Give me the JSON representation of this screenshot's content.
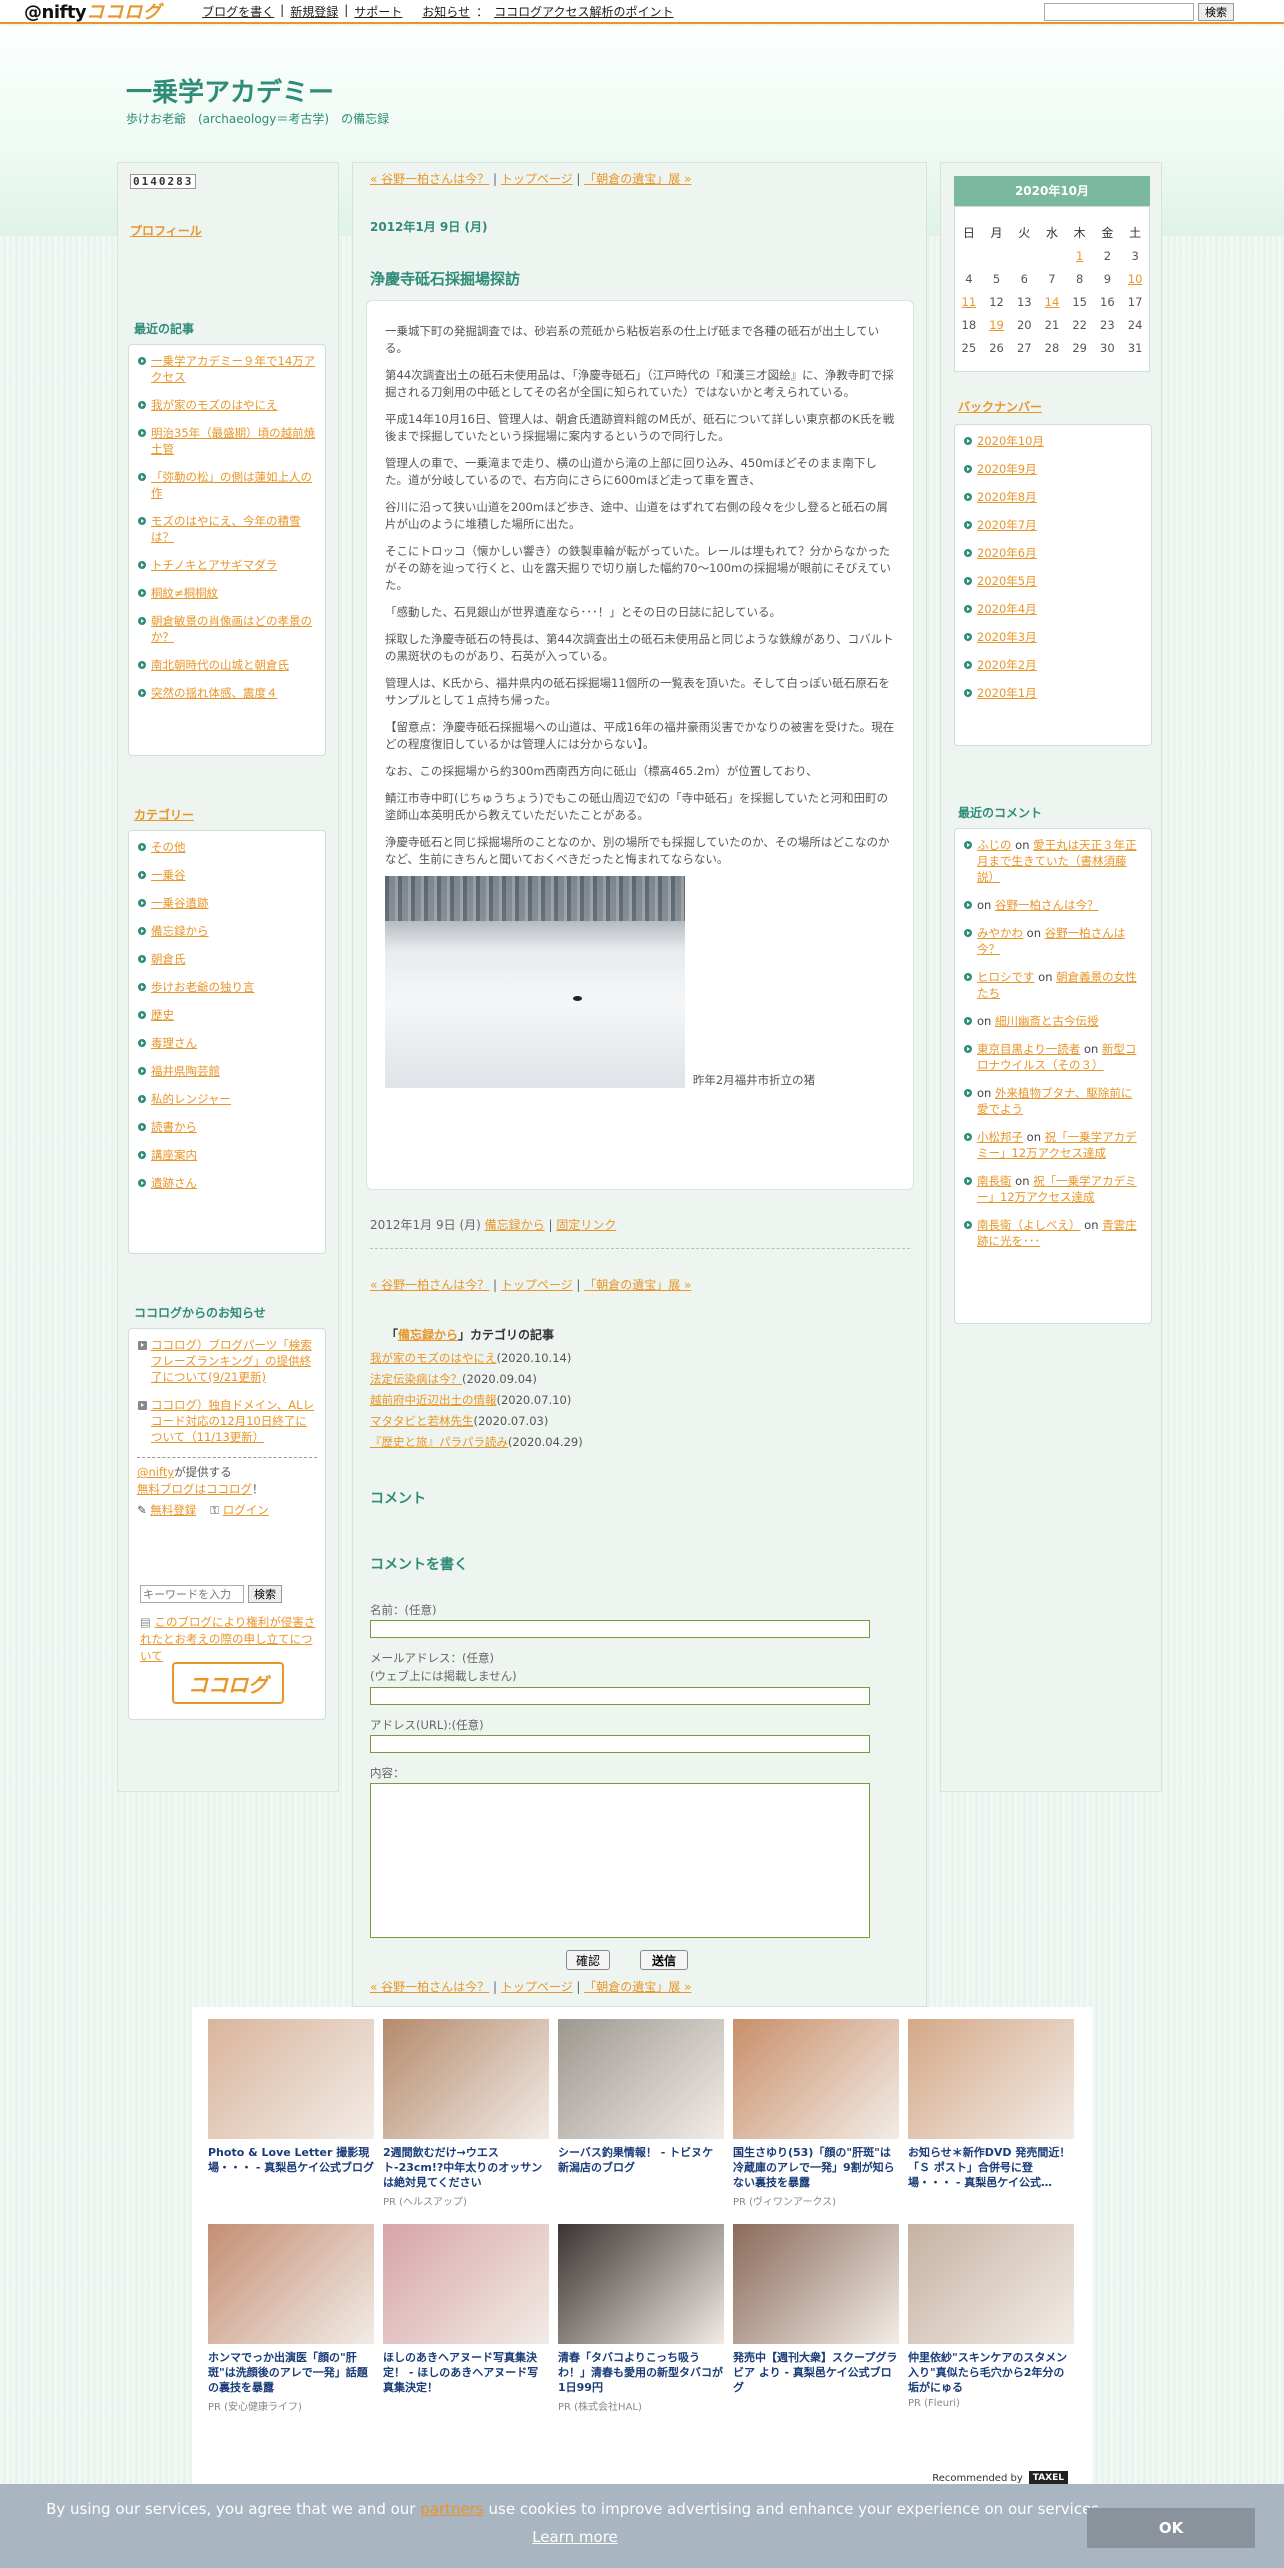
{
  "topbar": {
    "logo_text": "@nifty",
    "logo_brand": "ココログ",
    "nav": [
      "ブログを書く",
      "新規登録",
      "サポート"
    ],
    "news_label": "お知らせ",
    "news_link": "ココログアクセス解析のポイント",
    "search_button": "検索"
  },
  "site": {
    "title": "一乗学アカデミー",
    "description": "歩けお老爺　(archaeology＝考古学)　の備忘録"
  },
  "left": {
    "counter": "0140283",
    "profile": "プロフィール",
    "recent_heading": "最近の記事",
    "recent_items": [
      "一乗学アカデミー９年で14万アクセス",
      "我が家のモズのはやにえ",
      "明治35年（最盛期）頃の越前焼土管",
      "「弥勒の松」の側は蓮如上人の作",
      "モズのはやにえ、今年の積雪は？",
      "トチノキとアサギマダラ",
      "桐紋≠桐桐紋",
      "朝倉敏景の肖像画はどの孝景のか？",
      "南北朝時代の山城と朝倉氏",
      "突然の揺れ体感、震度４"
    ],
    "category_heading": "カテゴリー",
    "category_items": [
      "その他",
      "一乗谷",
      "一乗谷遺跡",
      "備忘録から",
      "朝倉氏",
      "歩けお老爺の独り言",
      "歴史",
      "毒理さん",
      "福井県陶芸館",
      "私的レンジャー",
      "読書から",
      "講座案内",
      "遺跡さん"
    ],
    "notice_heading": "ココログからのお知らせ",
    "notice_items": [
      "ココログ）ブログパーツ「検索フレーズランキング」の提供終了について(9/21更新)",
      "ココログ）独自ドメイン、ALレコード対応の12月10日終了について（11/13更新）"
    ],
    "provided_by": "@nifty",
    "provided_text": "が提供する",
    "free_blog": "無料ブログはココログ",
    "free_blog_suffix": "！",
    "register": "無料登録",
    "login": "ログイン",
    "search_placeholder": "キーワードを入力",
    "search_button": "検索",
    "rights_notice": "このブログにより権利が侵害されたとお考えの際の申し立てについて",
    "logo_badge": "ココログ"
  },
  "main": {
    "nav_prev": "« 谷野一柏さんは今？",
    "nav_top": "トップページ",
    "nav_next": "「朝倉の遺宝」展 »",
    "date": "2012年1月 9日 (月)",
    "title": "浄慶寺砥石採掘場探訪",
    "paragraphs": [
      "一乗城下町の発掘調査では、砂岩系の荒砥から粘板岩系の仕上げ砥まで各種の砥石が出土している。",
      "第44次調査出土の砥石未使用品は、「浄慶寺砥石」（江戸時代の『和漢三才図絵』に、浄教寺町で採掘される刀剣用の中砥としてその名が全国に知られていた）ではないかと考えられている。",
      "平成14年10月16日、管理人は、朝倉氏遺跡資料館のM氏が、砥石について詳しい東京都のK氏を戦後まで採掘していたという採掘場に案内するというので同行した。",
      "管理人の車で、一乗滝まで走り、横の山道から滝の上部に回り込み、450mほどそのまま南下した。道が分岐しているので、右方向にさらに600mほど走って車を置き、",
      "谷川に沿って狭い山道を200mほど歩き、途中、山道をはずれて右側の段々を少し登ると砥石の屑片が山のように堆積した場所に出た。",
      "そこにトロッコ（懐かしい響き）の鉄製車輪が転がっていた。レールは埋もれて？分からなかったがその跡を辿って行くと、山を露天掘りで切り崩した幅約70～100mの採掘場が眼前にそびえていた。",
      "「感動した、石見銀山が世界遺産なら･･･！」とその日の日誌に記している。",
      "採取した浄慶寺砥石の特長は、第44次調査出土の砥石未使用品と同じような鉄線があり、コバルトの黒斑状のものがあり、石英が入っている。",
      "管理人は、K氏から、福井県内の砥石採掘場11個所の一覧表を頂いた。そして白っぽい砥石原石をサンプルとして１点持ち帰った。",
      "【留意点：浄慶寺砥石採掘場への山道は、平成16年の福井豪雨災害でかなりの被害を受けた。現在どの程度復旧しているかは管理人には分からない】。",
      "なお、この採掘場から約300m西南西方向に砥山（標高465.2m）が位置しており、",
      "鯖江市寺中町(じちゅうちょう)でもこの砥山周辺で幻の「寺中砥石」を採掘していたと河和田町の塗師山本英明氏から教えていただいたことがある。",
      "浄慶寺砥石と同じ採掘場所のことなのか、別の場所でも採掘していたのか、その場所はどこなのかなど、生前にきちんと聞いておくべきだったと悔まれてならない。"
    ],
    "photo_caption": "昨年2月福井市折立の猪",
    "foot_date": "2012年1月 9日 (月)",
    "foot_category": "備忘録から",
    "foot_permalink": "固定リンク",
    "cat_articles_open": "「",
    "cat_articles_cat": "備忘録から",
    "cat_articles_close": "」カテゴリの記事",
    "cat_articles": [
      {
        "title": "我が家のモズのはやにえ",
        "date": "(2020.10.14)"
      },
      {
        "title": "法定伝染病は今？",
        "date": "(2020.09.04)"
      },
      {
        "title": "越前府中近辺出土の情報",
        "date": "(2020.07.10)"
      },
      {
        "title": "マタタビと若林先生",
        "date": "(2020.07.03)"
      },
      {
        "title": "『歴史と旅』パラパラ読み",
        "date": "(2020.04.29)"
      }
    ],
    "comment_heading": "コメント",
    "write_heading": "コメントを書く",
    "label_name": "名前：(任意)",
    "label_email": "メールアドレス：(任意)",
    "label_email_note": "(ウェブ上には掲載しません)",
    "label_url": "アドレス(URL):(任意)",
    "label_body": "内容：",
    "confirm_button": "確認",
    "submit_button": "送信"
  },
  "right": {
    "calendar_title": "2020年10月",
    "weekdays": [
      "日",
      "月",
      "火",
      "水",
      "木",
      "金",
      "土"
    ],
    "weeks": [
      [
        "",
        "",
        "",
        "",
        "1",
        "2",
        "3"
      ],
      [
        "4",
        "5",
        "6",
        "7",
        "8",
        "9",
        "10"
      ],
      [
        "11",
        "12",
        "13",
        "14",
        "15",
        "16",
        "17"
      ],
      [
        "18",
        "19",
        "20",
        "21",
        "22",
        "23",
        "24"
      ],
      [
        "25",
        "26",
        "27",
        "28",
        "29",
        "30",
        "31"
      ]
    ],
    "linked_days": [
      "1",
      "10",
      "11",
      "14",
      "19"
    ],
    "backnumber_heading": "バックナンバー",
    "backnumbers": [
      "2020年10月",
      "2020年9月",
      "2020年8月",
      "2020年7月",
      "2020年6月",
      "2020年5月",
      "2020年4月",
      "2020年3月",
      "2020年2月",
      "2020年1月"
    ],
    "comments_heading": "最近のコメント",
    "comments": [
      {
        "who": "ふじの",
        "on": "on",
        "what": "愛王丸は天正３年正月まで生きていた（書林須藤説）"
      },
      {
        "who": "",
        "on": "on",
        "what": "谷野一柏さんは今？"
      },
      {
        "who": "みやかわ",
        "on": "on",
        "what": "谷野一柏さんは今？"
      },
      {
        "who": "ヒロシです",
        "on": "on",
        "what": "朝倉義景の女性たち"
      },
      {
        "who": "",
        "on": "on",
        "what": "細川幽斎と古今伝授"
      },
      {
        "who": "東京目黒より一読者",
        "on": "on",
        "what": "新型コロナウイルス（その３）"
      },
      {
        "who": "",
        "on": "on",
        "what": "外来植物ブタナ、駆除前に愛でよう"
      },
      {
        "who": "小松邦子",
        "on": "on",
        "what": "祝「一乗学アカデミー」12万アクセス達成"
      },
      {
        "who": "南長衛",
        "on": "on",
        "what": "祝「一乗学アカデミー」12万アクセス達成"
      },
      {
        "who": "南長衛（よしべえ）",
        "on": "on",
        "what": "青雲庄跡に光を･･･"
      }
    ]
  },
  "ads": {
    "items": [
      {
        "title": "Photo & Love Letter 撮影現場・・・ - 真梨邑ケイ公式ブログ",
        "pr": "",
        "color": "#d9b49c"
      },
      {
        "title": "2週間飲むだけ→ウエスト-23cm!?中年太りのオッサンは絶対見てください",
        "pr": "PR (ヘルスアップ)",
        "color": "#b48a6c"
      },
      {
        "title": "シーバス釣果情報！ - トビヌケ新潟店のブログ",
        "pr": "",
        "color": "#9c9890"
      },
      {
        "title": "国生さゆり(53)「顔の\"肝斑\"は冷蔵庫のアレで一発」9割が知らない裏技を暴露",
        "pr": "PR (ヴィワンアークス)",
        "color": "#c98f6a"
      },
      {
        "title": "お知らせ＊新作DVD 発売間近！「Ｓ ポスト」合併号に登場・・・ - 真梨邑ケイ公式…",
        "pr": "",
        "color": "#d4a888"
      },
      {
        "title": "ホンマでっか出演医「顔の\"肝斑\"は洗顔後のアレで一発」話題の裏技を暴露",
        "pr": "PR (安心健康ライフ)",
        "color": "#c48e74"
      },
      {
        "title": "ほしのあきヘアヌード写真集決定！ - ほしのあきヘアヌード写真集決定！",
        "pr": "",
        "color": "#d7a4a8"
      },
      {
        "title": "清春「タバコよりこっち吸うわ！」清春も愛用の新型タバコが1日99円",
        "pr": "PR (株式会社HAL)",
        "color": "#3a3432"
      },
      {
        "title": "発売中【週刊大衆】スクープグラビア より - 真梨邑ケイ公式ブログ",
        "pr": "",
        "color": "#8a6a5a"
      },
      {
        "title": "仲里依紗\"スキンケアのスタメン入り\"真似たら毛穴から2年分の垢がにゅる",
        "pr": "PR (Fleuri)",
        "color": "#c6b2a2"
      }
    ],
    "recommended": "Recommended by",
    "recommended_brand": "TAXEL"
  },
  "cookie": {
    "message_before": "By using our services, you agree that we and our",
    "message_link": "partners",
    "message_after": "use cookies to improve advertising and enhance your experience on our services.",
    "learn_more": "Learn more",
    "ok": "OK"
  }
}
